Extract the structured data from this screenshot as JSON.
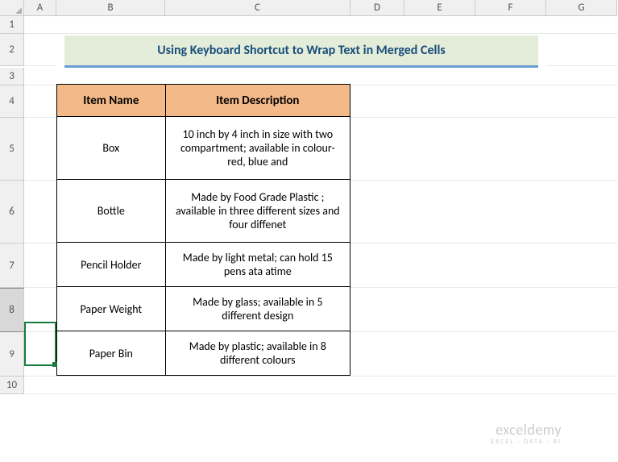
{
  "columns": [
    "",
    "A",
    "B",
    "C",
    "D",
    "E",
    "F",
    "G"
  ],
  "rowNumbers": [
    "1",
    "2",
    "3",
    "4",
    "5",
    "6",
    "7",
    "8",
    "9",
    "10"
  ],
  "selectedRow": "8",
  "title": "Using Keyboard Shortcut to Wrap Text in Merged Cells",
  "headers": {
    "name": "Item Name",
    "desc": "Item Description"
  },
  "rows": [
    {
      "name": "Box",
      "desc": "10 inch by 4 inch in size with two compartment; available in colour-red, blue and"
    },
    {
      "name": "Bottle",
      "desc": "Made by Food Grade Plastic ; available in three different sizes and four diffenet"
    },
    {
      "name": "Pencil Holder",
      "desc": "Made by light metal; can hold 15 pens ata atime"
    },
    {
      "name": "Paper Weight",
      "desc": "Made by glass; available in 5 different design"
    },
    {
      "name": "Paper Bin",
      "desc": "Made by plastic; available in 8 different colours"
    }
  ],
  "watermark": {
    "brand": "exceldemy",
    "tagline": "EXCEL · DATA · BI"
  },
  "chart_data": {
    "type": "table",
    "title": "Using Keyboard Shortcut to Wrap Text in Merged Cells",
    "columns": [
      "Item Name",
      "Item Description"
    ],
    "rows": [
      [
        "Box",
        "10 inch by 4 inch in size with two compartment; available in colour-red, blue and"
      ],
      [
        "Bottle",
        "Made by Food Grade Plastic ; available in three different sizes and four diffenet"
      ],
      [
        "Pencil Holder",
        "Made by light metal; can hold 15 pens ata atime"
      ],
      [
        "Paper Weight",
        "Made by glass; available in 5 different design"
      ],
      [
        "Paper Bin",
        "Made by plastic; available in 8 different colours"
      ]
    ]
  }
}
